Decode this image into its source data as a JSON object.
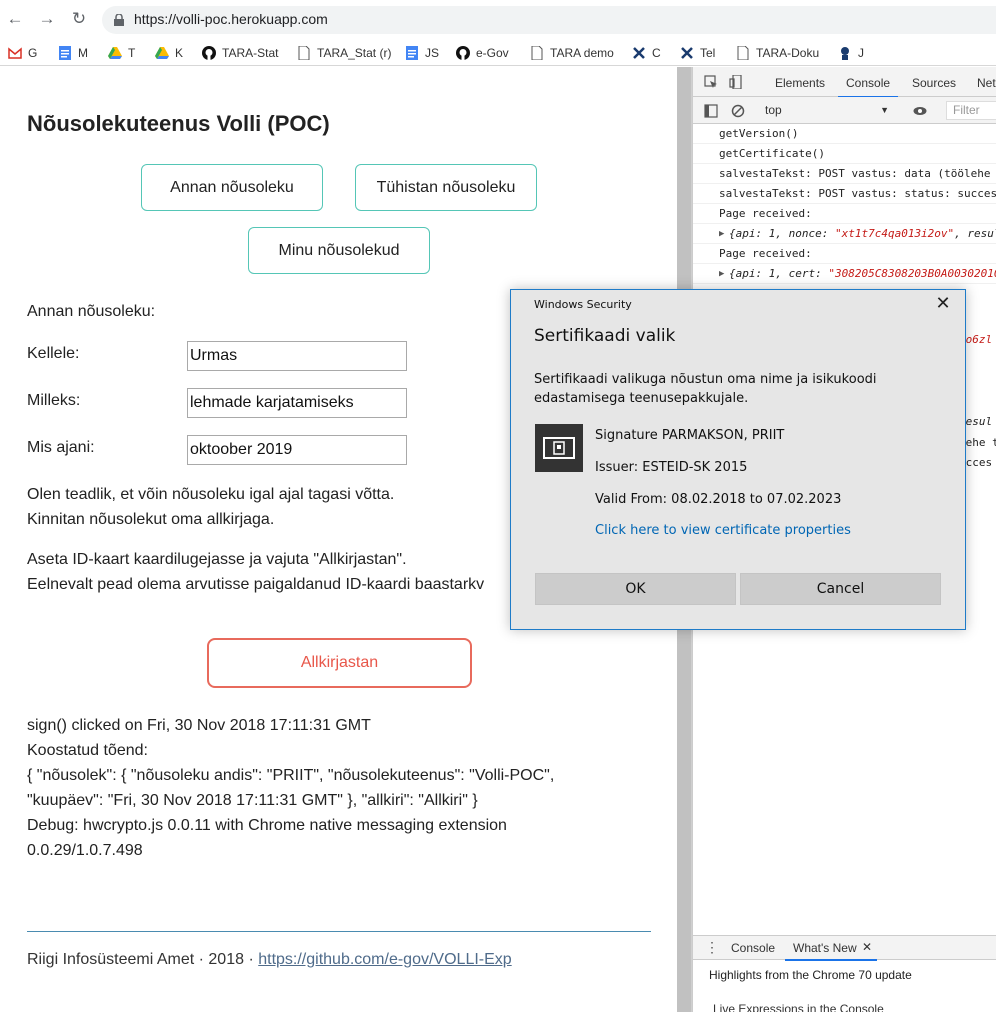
{
  "browser": {
    "url": "https://volli-poc.herokuapp.com",
    "bookmarks": [
      {
        "label": "G",
        "icon": "gmail-icon"
      },
      {
        "label": "M",
        "icon": "docs-icon"
      },
      {
        "label": "T",
        "icon": "drive-icon"
      },
      {
        "label": "K",
        "icon": "drive-icon"
      },
      {
        "label": "TARA-Stat",
        "icon": "github-icon"
      },
      {
        "label": "TARA_Stat (r)",
        "icon": "page-icon"
      },
      {
        "label": "JS",
        "icon": "docs-icon"
      },
      {
        "label": "e-Gov",
        "icon": "github-icon"
      },
      {
        "label": "TARA demo",
        "icon": "page-icon"
      },
      {
        "label": "C",
        "icon": "tools-icon"
      },
      {
        "label": "Tel",
        "icon": "tools-icon"
      },
      {
        "label": "TARA-Doku",
        "icon": "page-icon"
      },
      {
        "label": "J",
        "icon": "jenkins-icon"
      }
    ]
  },
  "page": {
    "title": "Nõusolekuteenus Volli (POC)",
    "buttons": {
      "give": "Annan nõusoleku",
      "revoke": "Tühistan nõusoleku",
      "mine": "Minu nõusolekud"
    },
    "form": {
      "heading": "Annan nõusoleku:",
      "to_label": "Kellele:",
      "to_value": "Urmas",
      "purpose_label": "Milleks:",
      "purpose_value": "lehmade karjatamiseks",
      "until_label": "Mis ajani:",
      "until_value": "oktoober 2019"
    },
    "notice": {
      "line1": "Olen teadlik, et võin nõusoleku igal ajal tagasi võtta.",
      "line2": "Kinnitan nõusolekut oma allkirjaga."
    },
    "instruction": {
      "line1": "Aseta ID-kaart kaardilugejasse ja vajuta \"Allkirjastan\".",
      "line2": "Eelnevalt pead olema arvutisse paigaldanud ID-kaardi baastarkv"
    },
    "sign_button": "Allkirjastan",
    "result": {
      "line1": "sign() clicked on Fri, 30 Nov 2018 17:11:31 GMT",
      "line2": "Koostatud tõend:",
      "line3": "{ \"nõusolek\": { \"nõusoleku andis\": \"PRIIT\", \"nõusolekuteenus\": \"Volli-POC\",",
      "line4": "\"kuupäev\": \"Fri, 30 Nov 2018 17:11:31 GMT\" }, \"allkiri\": \"Allkiri\" }",
      "line5": "Debug: hwcrypto.js 0.0.11 with Chrome native messaging extension",
      "line6": "0.0.29/1.0.7.498"
    },
    "footer": {
      "text": "Riigi Infosüsteemi Amet · 2018 · ",
      "link": "https://github.com/e-gov/VOLLI-Exp"
    }
  },
  "devtools": {
    "tabs": [
      "Elements",
      "Console",
      "Sources",
      "Net"
    ],
    "active_tab": "Console",
    "context": "top",
    "filter_placeholder": "Filter",
    "lines": [
      {
        "text": "getVersion()"
      },
      {
        "text": "getCertificate()"
      },
      {
        "text": "salvestaTekst: POST vastus: data (töölehe t"
      },
      {
        "text": "salvestaTekst: POST vastus: status: succes"
      },
      {
        "text": "Page received:"
      },
      {
        "obj_prefix": "{api: 1, nonce: ",
        "obj_str": "\"xt1t7c4qa013i2ov\"",
        "obj_suffix": ", resul"
      },
      {
        "text": "Page received:"
      },
      {
        "obj_prefix": "{api: 1, cert: ",
        "obj_str": "\"308205C8308203B0A00302010",
        "obj_suffix": ""
      }
    ],
    "hidden_fragments": {
      "a": "uo6zl",
      "b": "resul",
      "c": "lehe t",
      "d": "ucces"
    },
    "drawer": {
      "tabs": [
        "Console",
        "What's New"
      ],
      "active": "What's New",
      "highlights": "Highlights from the Chrome 70 update",
      "live_expressions": "Live Expressions in the Console"
    }
  },
  "dialog": {
    "app": "Windows Security",
    "title": "Sertifikaadi valik",
    "desc_line1": "Sertifikaadi valikuga nõustun oma nime ja isikukoodi",
    "desc_line2": "edastamisega teenusepakkujale.",
    "cert_name": "Signature PARMAKSON, PRIIT",
    "issuer": "Issuer: ESTEID-SK 2015",
    "valid": "Valid From: 08.02.2018 to 07.02.2023",
    "link": "Click here to view certificate properties",
    "ok": "OK",
    "cancel": "Cancel"
  }
}
